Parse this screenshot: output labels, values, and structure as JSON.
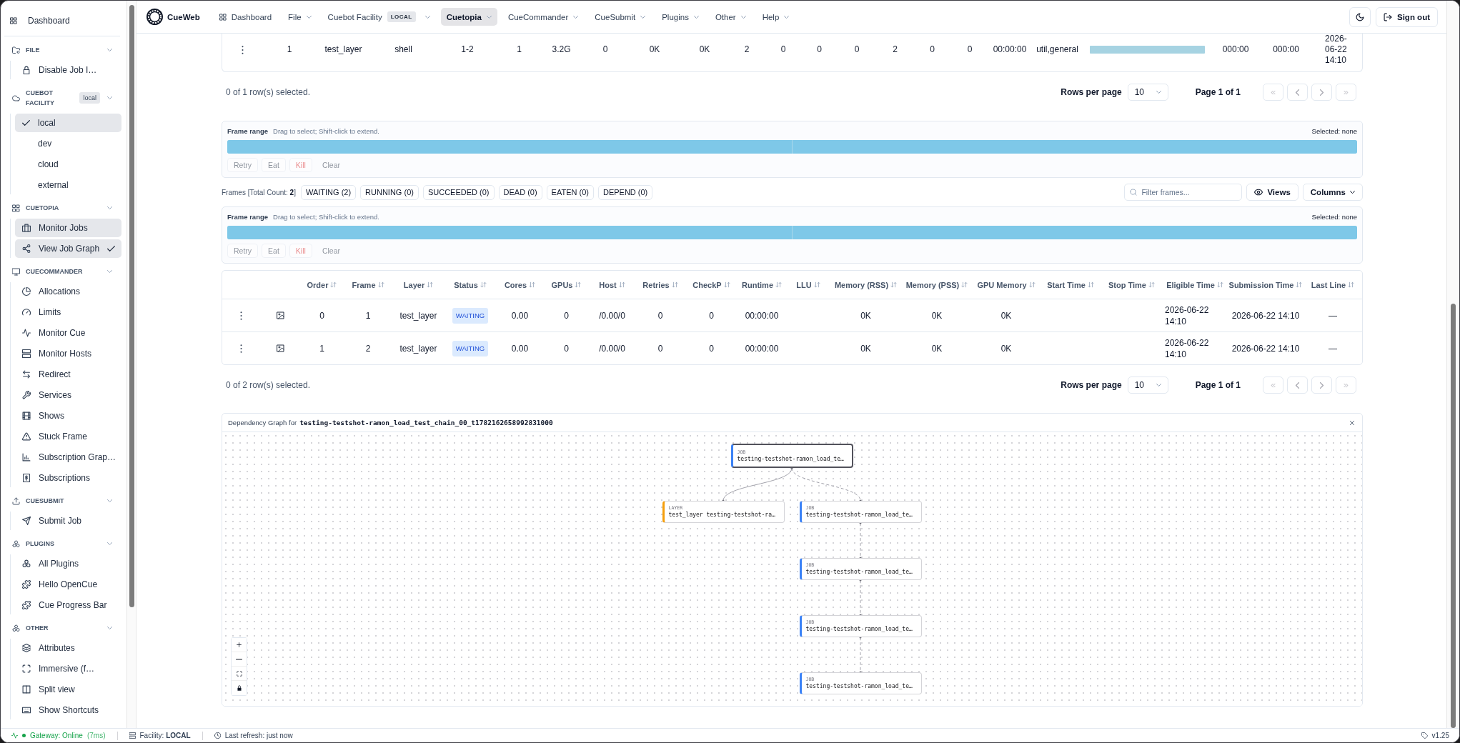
{
  "topbar": {
    "logo": "CueWeb",
    "nav": [
      {
        "label": "Dashboard",
        "kind": "link",
        "selected": false
      },
      {
        "label": "File",
        "kind": "menu",
        "selected": false
      },
      {
        "label": "Cuebot Facility",
        "kind": "menu",
        "badge": "LOCAL",
        "selected": false
      },
      {
        "label": "Cuetopia",
        "kind": "menu",
        "selected": true
      },
      {
        "label": "CueCommander",
        "kind": "menu",
        "selected": false
      },
      {
        "label": "CueSubmit",
        "kind": "menu",
        "selected": false
      },
      {
        "label": "Plugins",
        "kind": "menu",
        "selected": false
      },
      {
        "label": "Other",
        "kind": "menu",
        "selected": false
      },
      {
        "label": "Help",
        "kind": "menu",
        "selected": false
      }
    ],
    "sign_out": "Sign out"
  },
  "sidebar": {
    "dashboard": "Dashboard",
    "sections": [
      {
        "title": "FILE",
        "kind": "menu",
        "expanded": true,
        "items": [
          {
            "label": "Disable Job I…",
            "selected": false,
            "checked": false
          }
        ]
      },
      {
        "title": "CUEBOT FACILITY",
        "kind": "choice",
        "badge": "local",
        "expanded": true,
        "items": [
          {
            "label": "local",
            "selected": true
          },
          {
            "label": "dev",
            "selected": false
          },
          {
            "label": "cloud",
            "selected": false
          },
          {
            "label": "external",
            "selected": false
          }
        ]
      },
      {
        "title": "CUETOPIA",
        "kind": "menu",
        "expanded": true,
        "items": [
          {
            "label": "Monitor Jobs",
            "selected": true,
            "checked": false
          },
          {
            "label": "View Job Graph",
            "selected": true,
            "checked": true
          }
        ]
      },
      {
        "title": "CUECOMMANDER",
        "kind": "menu",
        "expanded": true,
        "items": [
          {
            "label": "Allocations",
            "selected": false,
            "checked": false
          },
          {
            "label": "Limits",
            "selected": false,
            "checked": false
          },
          {
            "label": "Monitor Cue",
            "selected": false,
            "checked": false
          },
          {
            "label": "Monitor Hosts",
            "selected": false,
            "checked": false
          },
          {
            "label": "Redirect",
            "selected": false,
            "checked": false
          },
          {
            "label": "Services",
            "selected": false,
            "checked": false
          },
          {
            "label": "Shows",
            "selected": false,
            "checked": false
          },
          {
            "label": "Stuck Frame",
            "selected": false,
            "checked": false
          },
          {
            "label": "Subscription Grap…",
            "selected": false,
            "checked": false
          },
          {
            "label": "Subscriptions",
            "selected": false,
            "checked": false
          }
        ]
      },
      {
        "title": "CUESUBMIT",
        "kind": "menu",
        "expanded": true,
        "items": [
          {
            "label": "Submit Job",
            "selected": false,
            "checked": false
          }
        ]
      },
      {
        "title": "PLUGINS",
        "kind": "menu",
        "expanded": true,
        "items": [
          {
            "label": "All Plugins",
            "selected": false,
            "checked": false
          },
          {
            "label": "Hello OpenCue",
            "selected": false,
            "checked": false
          },
          {
            "label": "Cue Progress Bar",
            "selected": false,
            "checked": false
          }
        ]
      },
      {
        "title": "OTHER",
        "kind": "menu",
        "expanded": true,
        "items": [
          {
            "label": "Attributes",
            "selected": false,
            "checked": false
          },
          {
            "label": "Immersive (f…",
            "selected": false,
            "checked": false
          },
          {
            "label": "Split view",
            "selected": false,
            "checked": false
          },
          {
            "label": "Show Shortcuts",
            "selected": false,
            "checked": false
          }
        ]
      }
    ]
  },
  "layer_table": {
    "rows": [
      {
        "cells": [
          "1",
          "test_layer",
          "shell",
          "1-2",
          "1",
          "3.2G",
          "0",
          "0K",
          "0K",
          "2",
          "0",
          "0",
          "0",
          "2",
          "0",
          "0",
          "00:00:00",
          "util,general",
          "000:00",
          "000:00",
          "2026-06-22 14:10"
        ],
        "progress": {
          "level": 1
        }
      }
    ],
    "pagination": {
      "selection": "0 of 1 row(s) selected.",
      "rows_per_page_label": "Rows per page",
      "rows_per_page": "10",
      "page": "Page 1 of 1",
      "buttons_disabled": true
    }
  },
  "layer_frame_range": {
    "label": "Frame range",
    "hint": "Drag to select; Shift-click to extend.",
    "selection": "Selected: none",
    "frames": [
      {
        "selected": false
      },
      {
        "selected": false
      }
    ],
    "buttons": [
      {
        "label": "Retry",
        "kind": "outline",
        "disabled": true
      },
      {
        "label": "Eat",
        "kind": "outline",
        "disabled": true
      },
      {
        "label": "Kill",
        "kind": "danger",
        "disabled": true
      },
      {
        "label": "Clear",
        "kind": "plain",
        "disabled": true
      }
    ]
  },
  "frames": {
    "title": "Frames [Total Count: **2**]",
    "filters": [
      {
        "label": "WAITING (2)",
        "selected": false
      },
      {
        "label": "RUNNING (0)",
        "selected": false
      },
      {
        "label": "SUCCEEDED (0)",
        "selected": false
      },
      {
        "label": "DEAD (0)",
        "selected": false
      },
      {
        "label": "EATEN (0)",
        "selected": false
      },
      {
        "label": "DEPEND (0)",
        "selected": false
      }
    ],
    "search": {
      "placeholder": "Filter frames..."
    },
    "views": "Views",
    "columns_button": "Columns",
    "frame_range": {
      "label": "Frame range",
      "hint": "Drag to select; Shift-click to extend.",
      "selection": "Selected: none",
      "frames": [
        {
          "selected": false
        },
        {
          "selected": false
        }
      ],
      "buttons": [
        {
          "label": "Retry",
          "kind": "outline",
          "disabled": true
        },
        {
          "label": "Eat",
          "kind": "outline",
          "disabled": true
        },
        {
          "label": "Kill",
          "kind": "danger",
          "disabled": true
        },
        {
          "label": "Clear",
          "kind": "plain",
          "disabled": true
        }
      ]
    },
    "table": {
      "columns": [
        {
          "label": "Order",
          "kind": "text"
        },
        {
          "label": "Frame",
          "kind": "text"
        },
        {
          "label": "Layer",
          "kind": "text"
        },
        {
          "label": "Status",
          "kind": "badge"
        },
        {
          "label": "Cores",
          "kind": "text"
        },
        {
          "label": "GPUs",
          "kind": "text"
        },
        {
          "label": "Host",
          "kind": "text"
        },
        {
          "label": "Retries",
          "kind": "text"
        },
        {
          "label": "CheckP",
          "kind": "text"
        },
        {
          "label": "Runtime",
          "kind": "text"
        },
        {
          "label": "LLU",
          "kind": "text"
        },
        {
          "label": "Memory (RSS)",
          "kind": "text"
        },
        {
          "label": "Memory (PSS)",
          "kind": "text"
        },
        {
          "label": "GPU Memory",
          "kind": "text"
        },
        {
          "label": "Start Time",
          "kind": "text"
        },
        {
          "label": "Stop Time",
          "kind": "text"
        },
        {
          "label": "Eligible Time",
          "kind": "text"
        },
        {
          "label": "Submission Time",
          "kind": "text"
        },
        {
          "label": "Last Line",
          "kind": "text"
        }
      ],
      "rows": [
        {
          "cells": [
            "0",
            "1",
            "test_layer",
            "WAITING",
            "0.00",
            "0",
            "/0.00/0",
            "0",
            "0",
            "00:00:00",
            null,
            "0K",
            "0K",
            "0K",
            null,
            null,
            "2026-06-22 14:10",
            "2026-06-22 14:10",
            "—"
          ]
        },
        {
          "cells": [
            "1",
            "2",
            "test_layer",
            "WAITING",
            "0.00",
            "0",
            "/0.00/0",
            "0",
            "0",
            "00:00:00",
            null,
            "0K",
            "0K",
            "0K",
            null,
            null,
            "2026-06-22 14:10",
            "2026-06-22 14:10",
            "—"
          ]
        }
      ]
    },
    "pagination": {
      "selection": "0 of 2 row(s) selected.",
      "rows_per_page_label": "Rows per page",
      "rows_per_page": "10",
      "page": "Page 1 of 1",
      "buttons_disabled": true
    }
  },
  "dependency_graph": {
    "title": "Dependency Graph for",
    "job": "testing-testshot-ramon_load_test_chain_00_t1782162658992831000",
    "root": {
      "kind": "job",
      "type": "JOB",
      "name": "testing-testshot-ramon_load_te…",
      "selected": true,
      "children": [
        {
          "kind": "layer",
          "type": "LAYER",
          "name": "test_layer testing-testshot-ra…",
          "dashed": false,
          "selected": false
        },
        {
          "kind": "job",
          "type": "JOB",
          "name": "testing-testshot-ramon_load_te…",
          "dashed": true,
          "selected": false,
          "children": [
            {
              "kind": "job",
              "type": "JOB",
              "name": "testing-testshot-ramon_load_te…",
              "dashed": true,
              "selected": false,
              "children": [
                {
                  "kind": "job",
                  "type": "JOB",
                  "name": "testing-testshot-ramon_load_te…",
                  "dashed": true,
                  "selected": false,
                  "children": [
                    {
                      "kind": "job",
                      "type": "JOB",
                      "name": "testing-testshot-ramon_load_te…",
                      "dashed": true,
                      "selected": false
                    }
                  ]
                }
              ]
            }
          ]
        }
      ]
    }
  },
  "status_bar": {
    "online": true,
    "gateway": "Gateway: Online",
    "latency": "(7ms)",
    "facility": "Facility: **LOCAL**",
    "refresh": "Last refresh: just now",
    "version": "v1.25"
  }
}
